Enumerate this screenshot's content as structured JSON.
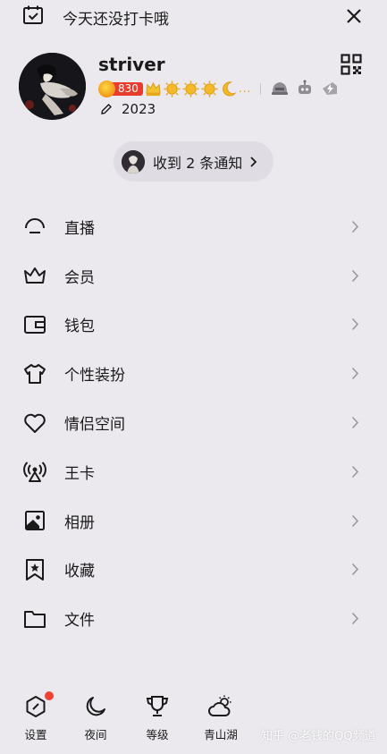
{
  "header": {
    "checkin_text": "今天还没打卡哦",
    "checkin_icon": "calendar-check-icon",
    "close_icon": "close-icon"
  },
  "profile": {
    "username": "striver",
    "level_number": "830",
    "level_dots": "...",
    "year": "2023",
    "qr_icon": "qr-code-icon",
    "accent_color": "#e83b2c"
  },
  "notification": {
    "text": "收到 2 条通知"
  },
  "menu": [
    {
      "label": "直播",
      "icon": "live-icon"
    },
    {
      "label": "会员",
      "icon": "crown-icon"
    },
    {
      "label": "钱包",
      "icon": "wallet-icon"
    },
    {
      "label": "个性装扮",
      "icon": "tshirt-icon"
    },
    {
      "label": "情侣空间",
      "icon": "heart-icon"
    },
    {
      "label": "王卡",
      "icon": "signal-tower-icon"
    },
    {
      "label": "相册",
      "icon": "photo-album-icon"
    },
    {
      "label": "收藏",
      "icon": "bookmark-star-icon"
    },
    {
      "label": "文件",
      "icon": "folder-icon"
    }
  ],
  "bottom_bar": [
    {
      "label": "设置",
      "icon": "settings-icon",
      "badge": true
    },
    {
      "label": "夜间",
      "icon": "moon-icon"
    },
    {
      "label": "等级",
      "icon": "trophy-icon"
    },
    {
      "label": "青山湖",
      "icon": "weather-cloud-sun-icon"
    }
  ],
  "watermark": "知乎 @老钱的QQ频道"
}
